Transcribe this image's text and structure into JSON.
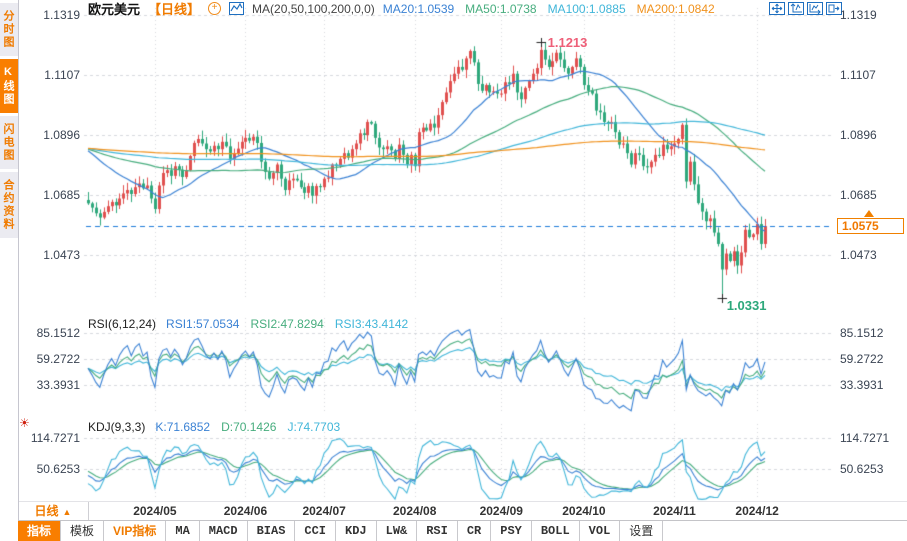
{
  "header": {
    "symbol": "欧元美元",
    "period_tag": "【日线】",
    "ma_settings": "MA(20,50,100,200,0,0)",
    "ma_values": [
      {
        "label": "MA20:1.0539",
        "color": "#3b82d4"
      },
      {
        "label": "MA50:1.0738",
        "color": "#47ad7e"
      },
      {
        "label": "MA100:1.0885",
        "color": "#41b6d9"
      },
      {
        "label": "MA200:1.0842",
        "color": "#f0921e"
      }
    ],
    "icons": [
      "add-indicator-icon",
      "mini-chart-icon",
      "pan-crosshair-icon",
      "scale-y-axis-icon",
      "scale-x-axis-icon",
      "exit-chart-icon"
    ]
  },
  "sidebar": {
    "items": [
      {
        "label": "分时图",
        "active": false
      },
      {
        "label": "K线图",
        "active": true
      },
      {
        "label": "闪电图",
        "active": false
      },
      {
        "label": "合约资料",
        "active": false
      }
    ]
  },
  "rsi": {
    "title": "RSI(6,12,24)",
    "values": [
      {
        "label": "RSI1:57.0534",
        "color": "#3b82d4"
      },
      {
        "label": "RSI2:47.8294",
        "color": "#47ad7e"
      },
      {
        "label": "RSI3:43.4142",
        "color": "#41b6d9"
      }
    ]
  },
  "kdj": {
    "title": "KDJ(9,3,3)",
    "values": [
      {
        "label": "K:71.6852",
        "color": "#3b82d4"
      },
      {
        "label": "D:70.1426",
        "color": "#47ad7e"
      },
      {
        "label": "J:74.7703",
        "color": "#41b6d9"
      }
    ]
  },
  "xaxis": {
    "period_button": "日线",
    "period_arrow": "▲",
    "labels": [
      "2024/05",
      "2024/06",
      "2024/07",
      "2024/08",
      "2024/09",
      "2024/10",
      "2024/11",
      "2024/12"
    ]
  },
  "bottom_toolbar": {
    "tabs": [
      {
        "label": "指标",
        "type": "active"
      },
      {
        "label": "模板"
      },
      {
        "label": "VIP指标",
        "type": "vip"
      },
      {
        "label": "MA",
        "type": "mono"
      },
      {
        "label": "MACD",
        "type": "mono"
      },
      {
        "label": "BIAS",
        "type": "mono"
      },
      {
        "label": "CCI",
        "type": "mono"
      },
      {
        "label": "KDJ",
        "type": "mono"
      },
      {
        "label": "LW&",
        "type": "mono"
      },
      {
        "label": "RSI",
        "type": "mono"
      },
      {
        "label": "CR",
        "type": "mono"
      },
      {
        "label": "PSY",
        "type": "mono"
      },
      {
        "label": "BOLL",
        "type": "mono"
      },
      {
        "label": "VOL",
        "type": "mono"
      },
      {
        "label": "设置"
      }
    ]
  },
  "colors": {
    "up": "#e0504f",
    "down": "#2fa87c",
    "blue": "#3b82d4",
    "green": "#47ad7e",
    "cyan": "#41b6d9",
    "orange": "#f0921e",
    "price_line": "#1d7bd8",
    "accent": "#f97e00",
    "grid": "#d6d8de"
  },
  "chart_data": {
    "type": "candlestick",
    "title": "欧元美元 EUR/USD 日线 (daily K-line) with MA(20,50,100,200), RSI(6,12,24), KDJ(9,3,3)",
    "y_ticks": [
      1.1319,
      1.1107,
      1.0896,
      1.0685,
      1.0473
    ],
    "x_tick_labels": [
      "2024/05",
      "2024/06",
      "2024/07",
      "2024/08",
      "2024/09",
      "2024/10",
      "2024/11",
      "2024/12"
    ],
    "x_tick_indices": [
      17,
      40,
      60,
      83,
      105,
      126,
      149,
      170
    ],
    "closes": [
      1.0655,
      1.064,
      1.062,
      1.0605,
      1.0625,
      1.0645,
      1.066,
      1.0648,
      1.0672,
      1.069,
      1.0702,
      1.0688,
      1.0712,
      1.0725,
      1.0708,
      1.0718,
      1.0672,
      1.0635,
      1.0718,
      1.0762,
      1.0772,
      1.0752,
      1.0786,
      1.0774,
      1.0748,
      1.0772,
      1.0822,
      1.0868,
      1.0882,
      1.0866,
      1.0846,
      1.0838,
      1.0858,
      1.0846,
      1.0872,
      1.0856,
      1.0812,
      1.0832,
      1.0848,
      1.0872,
      1.0886,
      1.0876,
      1.089,
      1.0868,
      1.0802,
      1.0766,
      1.0742,
      1.0762,
      1.0792,
      1.0742,
      1.0702,
      1.0736,
      1.0742,
      1.0736,
      1.0712,
      1.0692,
      1.0716,
      1.0682,
      1.0716,
      1.0712,
      1.0742,
      1.0746,
      1.0792,
      1.0786,
      1.0812,
      1.0832,
      1.0816,
      1.0846,
      1.0866,
      1.0902,
      1.0896,
      1.0942,
      1.0936,
      1.0886,
      1.0852,
      1.0846,
      1.0856,
      1.0842,
      1.0812,
      1.0862,
      1.0826,
      1.0792,
      1.0826,
      1.0786,
      1.0906,
      1.0922,
      1.0912,
      1.0936,
      1.0922,
      1.0966,
      1.1012,
      1.1046,
      1.1086,
      1.1112,
      1.1136,
      1.1126,
      1.1166,
      1.1192,
      1.1152,
      1.1076,
      1.1052,
      1.1072,
      1.1046,
      1.105,
      1.1042,
      1.1042,
      1.1082,
      1.1076,
      1.1112,
      1.1046,
      1.1022,
      1.1062,
      1.1086,
      1.1112,
      1.1132,
      1.1196,
      1.1162,
      1.1136,
      1.1156,
      1.1186,
      1.1162,
      1.1132,
      1.1112,
      1.1136,
      1.1166,
      1.1136,
      1.1072,
      1.1052,
      1.1042,
      1.0982,
      1.0976,
      1.0942,
      1.0936,
      1.0942,
      1.0906,
      1.0862,
      1.0866,
      1.0832,
      1.0792,
      1.0832,
      1.0826,
      1.0786,
      1.0782,
      1.0802,
      1.0826,
      1.0822,
      1.0862,
      1.0846,
      1.0856,
      1.0866,
      1.0882,
      1.0932,
      1.0732,
      1.0802,
      1.0722,
      1.0656,
      1.0626,
      1.0592,
      1.0602,
      1.0552,
      1.0512,
      1.0422,
      1.0478,
      1.0452,
      1.0486,
      1.0436,
      1.0482,
      1.0562,
      1.0536,
      1.0546,
      1.0582,
      1.0512,
      1.0575
    ],
    "ma_windows": [
      20,
      50,
      100,
      200
    ],
    "ma_seed_price": 1.085,
    "rsi_periods": [
      6,
      12,
      24
    ],
    "rsi_axis": [
      85.1512,
      59.2722,
      33.3931
    ],
    "rsi_last": [
      57.0534,
      47.8294,
      43.4142
    ],
    "kdj_params": [
      9,
      3,
      3
    ],
    "kdj_axis": [
      114.7271,
      50.6253
    ],
    "kdj_last": [
      71.6852,
      70.1426,
      74.7703
    ],
    "annotations": {
      "high": {
        "price": 1.1213,
        "index": 115,
        "label": "1.1213"
      },
      "low": {
        "price": 1.0331,
        "index": 161,
        "label": "1.0331"
      },
      "last": {
        "price": 1.0575,
        "label": "1.0575"
      }
    }
  }
}
